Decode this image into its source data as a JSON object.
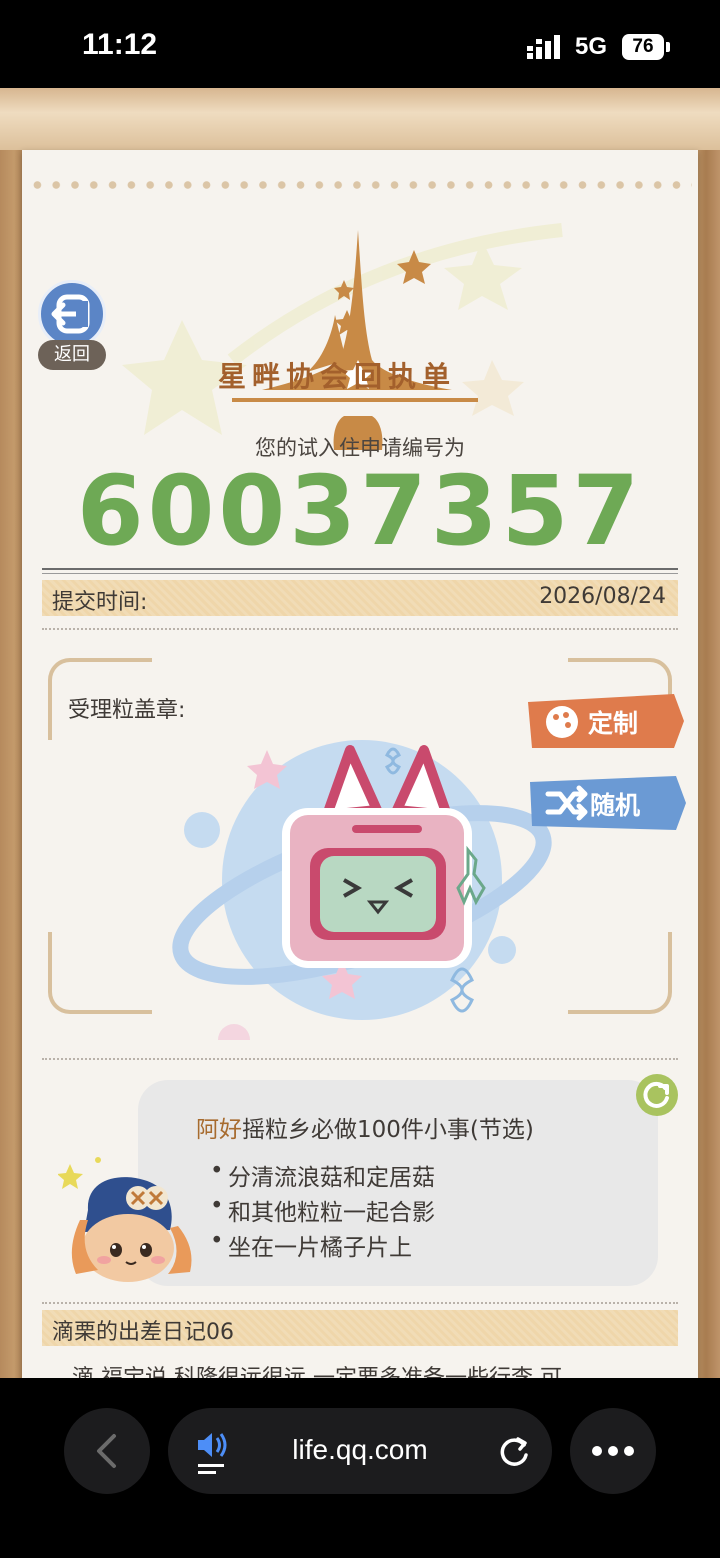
{
  "status": {
    "time": "11:12",
    "network": "5G",
    "battery": "76"
  },
  "header": {
    "back_label": "返回",
    "logo_title": "星畔协会回执单"
  },
  "application": {
    "intro": "您的试入住申请编号为",
    "number": "60037357"
  },
  "submit": {
    "label": "提交时间:",
    "date": "2026/08/24"
  },
  "stamp": {
    "label": "受理粒盖章:",
    "custom_label": "定制",
    "random_label": "随机"
  },
  "todo": {
    "title_name": "阿好",
    "title_rest": "摇粒乡必做100件小事(节选)",
    "items": [
      "分清流浪菇和定居菇",
      "和其他粒粒一起合影",
      "坐在一片橘子片上"
    ]
  },
  "diary": {
    "title": "滴栗的出差日记06",
    "first_line": "滴  福宝说  科隆很远很远  一定要多准备一些行李  可"
  },
  "browser": {
    "url": "life.qq.com"
  },
  "colors": {
    "accent_green": "#6ea955",
    "stamp_pink": "#c94a6d",
    "tag_orange": "#df7b4c",
    "tag_blue": "#6b9ad4"
  }
}
